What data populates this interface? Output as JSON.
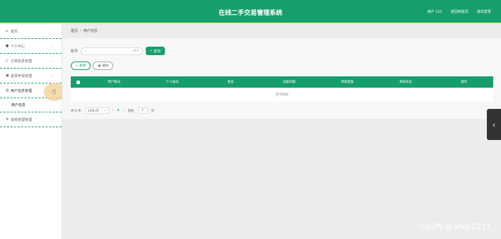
{
  "header": {
    "title": "在线二手交易管理系统",
    "right_links": [
      "用户 111",
      "返回到首页",
      "退出登录"
    ]
  },
  "sidebar": {
    "items": [
      {
        "label": "首页",
        "icon": "home-icon",
        "chevron": false
      },
      {
        "label": "个人中心",
        "icon": "user-icon",
        "chevron": true
      },
      {
        "label": "订单信息管理",
        "icon": "lock-icon",
        "chevron": true
      },
      {
        "label": "退货申请管理",
        "icon": "store-icon",
        "chevron": true
      },
      {
        "label": "用户信息管理",
        "icon": "chart-icon",
        "chevron": true,
        "active": true
      },
      {
        "label": "系统管理管理",
        "icon": "gear-icon",
        "chevron": true
      }
    ],
    "submenu": [
      "用户信息"
    ]
  },
  "breadcrumb": [
    "首页",
    "用户信息"
  ],
  "search": {
    "label": "账号",
    "placeholder": "账号",
    "query_button": "查询"
  },
  "actions": {
    "add_button": "+ 新增",
    "delete_button": "删除"
  },
  "table": {
    "columns": [
      "用户账号",
      "个人账号",
      "姓名",
      "注册日期",
      "审核回复",
      "审核状态",
      "操作"
    ],
    "empty_text": "暂无数据"
  },
  "pagination": {
    "total": "共 0 条",
    "page_size": "10条/页",
    "prev": "‹",
    "current": "1",
    "next": "›",
    "goto_prefix": "前往",
    "goto_value": "1",
    "goto_suffix": "页"
  },
  "side_tab": {
    "icon": "chevron-left-icon",
    "glyph": "‹"
  },
  "watermark": "CSDN @sheji1211",
  "colors": {
    "primary": "#179e6d",
    "accent_bar": "#e8f08a",
    "main_bg": "#ececec"
  }
}
